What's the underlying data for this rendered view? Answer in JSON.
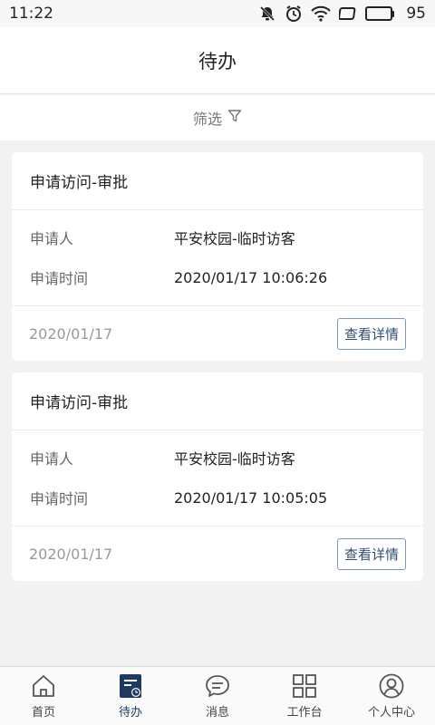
{
  "status_bar": {
    "time": "11:22",
    "battery_level": "95",
    "icons": [
      "mute-notification-icon",
      "alarm-icon",
      "wifi-icon",
      "screen-icon",
      "battery-icon"
    ]
  },
  "header": {
    "title": "待办"
  },
  "filter": {
    "label": "筛选",
    "icon": "filter-icon"
  },
  "cards": [
    {
      "title": "申请访问-审批",
      "rows": [
        {
          "label": "申请人",
          "value": "平安校园-临时访客"
        },
        {
          "label": "申请时间",
          "value": "2020/01/17 10:06:26"
        }
      ],
      "date": "2020/01/17",
      "button_label": "查看详情"
    },
    {
      "title": "申请访问-审批",
      "rows": [
        {
          "label": "申请人",
          "value": "平安校园-临时访客"
        },
        {
          "label": "申请时间",
          "value": "2020/01/17 10:05:05"
        }
      ],
      "date": "2020/01/17",
      "button_label": "查看详情"
    }
  ],
  "bottom_nav": {
    "items": [
      {
        "label": "首页",
        "icon": "home-icon",
        "active": false
      },
      {
        "label": "待办",
        "icon": "todo-icon",
        "active": true
      },
      {
        "label": "消息",
        "icon": "message-icon",
        "active": false
      },
      {
        "label": "工作台",
        "icon": "workbench-icon",
        "active": false
      },
      {
        "label": "个人中心",
        "icon": "profile-icon",
        "active": false
      }
    ]
  },
  "colors": {
    "accent": "#1e3a5f",
    "background": "#f2f2f2",
    "button_border": "#7c98b8"
  }
}
